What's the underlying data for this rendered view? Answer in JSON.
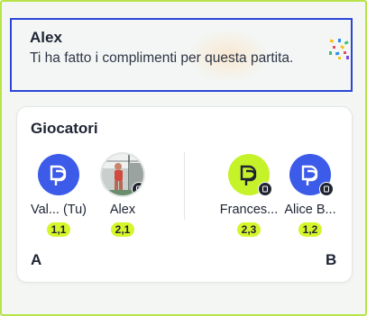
{
  "notification": {
    "sender": "Alex",
    "message": "Ti ha fatto i complimenti per questa partita.",
    "icon": "confetti-icon"
  },
  "players_card": {
    "title": "Giocatori",
    "team_a_label": "A",
    "team_b_label": "B",
    "team_a": [
      {
        "name": "Val... (Tu)",
        "level": "1,1",
        "avatar": "logo-avatar-blue"
      },
      {
        "name": "Alex",
        "level": "2,1",
        "avatar": "photo-avatar"
      }
    ],
    "team_b": [
      {
        "name": "Frances...",
        "level": "2,3",
        "avatar": "logo-avatar-lime"
      },
      {
        "name": "Alice B...",
        "level": "1,2",
        "avatar": "logo-avatar-blue"
      }
    ]
  },
  "colors": {
    "accent_lime": "#d6f52a",
    "brand_blue": "#3b5be8",
    "focus_border": "#2b46d6",
    "frame_border": "#b9e34a"
  }
}
